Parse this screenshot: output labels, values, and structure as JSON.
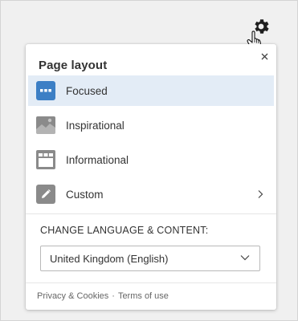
{
  "panel": {
    "title": "Page layout",
    "layouts": [
      {
        "label": "Focused",
        "icon": "focused-layout-icon",
        "selected": true
      },
      {
        "label": "Inspirational",
        "icon": "inspirational-layout-icon",
        "selected": false
      },
      {
        "label": "Informational",
        "icon": "informational-layout-icon",
        "selected": false
      },
      {
        "label": "Custom",
        "icon": "pencil-icon",
        "selected": false,
        "has_submenu": true
      }
    ],
    "language_section_label": "CHANGE LANGUAGE & CONTENT:",
    "language_select": {
      "value": "United Kingdom (English)"
    },
    "footer": {
      "privacy_link": "Privacy & Cookies",
      "separator": "·",
      "terms_link": "Terms of use"
    }
  },
  "colors": {
    "accent": "#3c7fc5",
    "selected_row": "#e3ecf6",
    "icon_gray": "#8a8a8a"
  }
}
